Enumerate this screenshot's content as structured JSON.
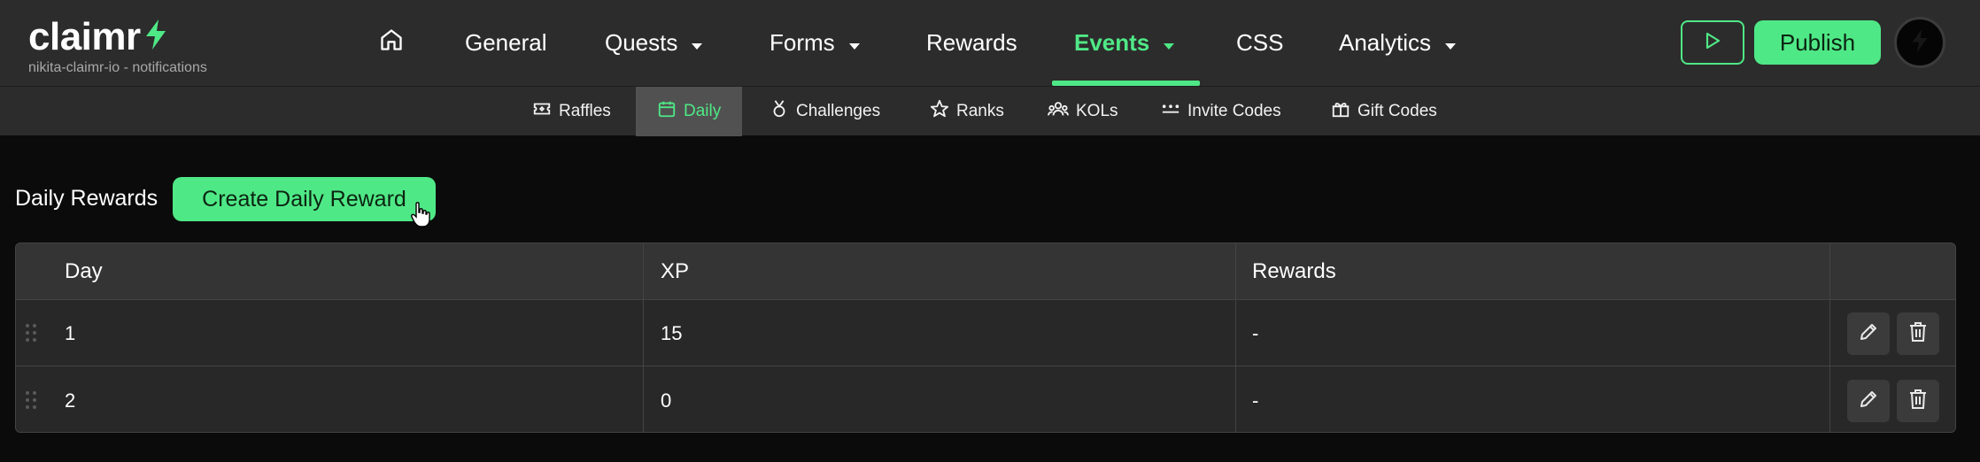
{
  "brand": {
    "name": "claimr",
    "subtitle": "nikita-claimr-io - notifications",
    "accent": "#4fe886"
  },
  "nav": {
    "items": [
      {
        "label": "General"
      },
      {
        "label": "Quests"
      },
      {
        "label": "Forms"
      },
      {
        "label": "Rewards"
      },
      {
        "label": "Events",
        "active": true
      },
      {
        "label": "CSS"
      },
      {
        "label": "Analytics"
      }
    ],
    "home_icon": "home-icon",
    "publish_label": "Publish",
    "preview_icon": "play-icon"
  },
  "subnav": {
    "items": [
      {
        "label": "Raffles",
        "icon": "ticket-icon"
      },
      {
        "label": "Daily",
        "icon": "calendar-icon",
        "active": true
      },
      {
        "label": "Challenges",
        "icon": "medal-icon"
      },
      {
        "label": "Ranks",
        "icon": "star-icon"
      },
      {
        "label": "KOLs",
        "icon": "users-icon"
      },
      {
        "label": "Invite Codes",
        "icon": "dots-icon"
      },
      {
        "label": "Gift Codes",
        "icon": "gift-icon"
      }
    ]
  },
  "page": {
    "title": "Daily Rewards",
    "create_label": "Create Daily Reward"
  },
  "table": {
    "headers": [
      "Day",
      "XP",
      "Rewards"
    ],
    "rows": [
      {
        "day": "1",
        "xp": "15",
        "rewards": "-"
      },
      {
        "day": "2",
        "xp": "0",
        "rewards": "-"
      }
    ]
  }
}
